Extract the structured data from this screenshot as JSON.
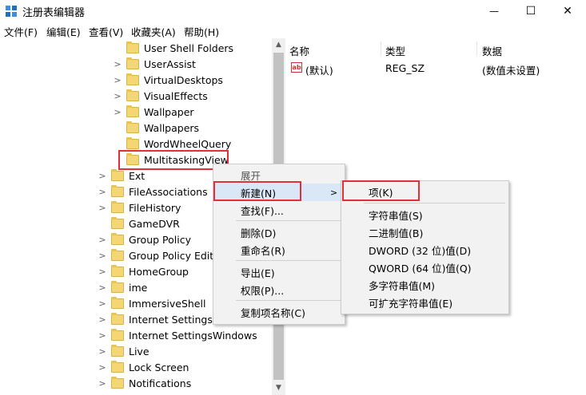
{
  "window": {
    "title": "注册表编辑器",
    "minimize_glyph": "—",
    "maximize_glyph": "☐",
    "close_glyph": "✕"
  },
  "menubar": [
    "文件(F)",
    "编辑(E)",
    "查看(V)",
    "收藏夹(A)",
    "帮助(H)"
  ],
  "tree": {
    "items": [
      {
        "label": "User Shell Folders",
        "chevron": ""
      },
      {
        "label": "UserAssist",
        "chevron": ">"
      },
      {
        "label": "VirtualDesktops",
        "chevron": ">"
      },
      {
        "label": "VisualEffects",
        "chevron": ">"
      },
      {
        "label": "Wallpaper",
        "chevron": ">"
      },
      {
        "label": "Wallpapers",
        "chevron": ""
      },
      {
        "label": "WordWheelQuery",
        "chevron": ""
      },
      {
        "label": "MultitaskingView",
        "chevron": ""
      },
      {
        "label": "Ext",
        "chevron": ">"
      },
      {
        "label": "FileAssociations",
        "chevron": ">"
      },
      {
        "label": "FileHistory",
        "chevron": ">"
      },
      {
        "label": "GameDVR",
        "chevron": ""
      },
      {
        "label": "Group Policy",
        "chevron": ">"
      },
      {
        "label": "Group Policy Editor",
        "chevron": ">"
      },
      {
        "label": "HomeGroup",
        "chevron": ">"
      },
      {
        "label": "ime",
        "chevron": ">"
      },
      {
        "label": "ImmersiveShell",
        "chevron": ">"
      },
      {
        "label": "Internet Settings",
        "chevron": ">"
      },
      {
        "label": "Internet SettingsWindows",
        "chevron": ">"
      },
      {
        "label": "Live",
        "chevron": ">"
      },
      {
        "label": "Lock Screen",
        "chevron": ">"
      },
      {
        "label": "Notifications",
        "chevron": ">"
      }
    ]
  },
  "list": {
    "headers": [
      "名称",
      "类型",
      "数据"
    ],
    "rows": [
      {
        "name": "(默认)",
        "type": "REG_SZ",
        "data": "(数值未设置)",
        "icon_text": "ab"
      }
    ]
  },
  "context_menu": {
    "items": [
      "展开",
      "新建(N)",
      "查找(F)...",
      "删除(D)",
      "重命名(R)",
      "导出(E)",
      "权限(P)...",
      "复制项名称(C)"
    ],
    "submenu_arrow": ">"
  },
  "submenu": {
    "items": [
      "项(K)",
      "字符串值(S)",
      "二进制值(B)",
      "DWORD (32 位)值(D)",
      "QWORD (64 位)值(Q)",
      "多字符串值(M)",
      "可扩充字符串值(E)"
    ]
  },
  "scroll_arrows": {
    "up": "▲",
    "down": "▼"
  },
  "colors": {
    "highlight": "#e0303a",
    "folder": "#f4d772",
    "menu_bg": "#f2f2f2",
    "menu_hover": "#d9e7f7"
  }
}
